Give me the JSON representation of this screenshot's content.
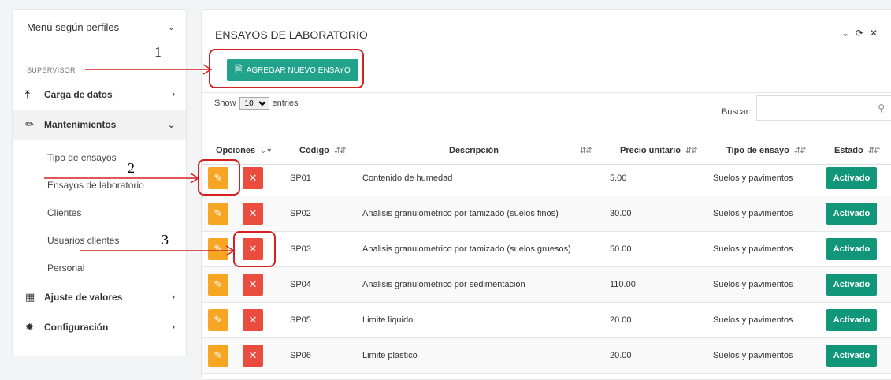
{
  "sidebar": {
    "title": "Menú según perfiles",
    "role": "SUPERVISOR",
    "items": [
      {
        "label": "Carga de datos",
        "icon": "upload-icon"
      },
      {
        "label": "Mantenimientos",
        "icon": "pencil-icon"
      },
      {
        "label": "Ajuste de valores",
        "icon": "calculator-icon"
      },
      {
        "label": "Configuración",
        "icon": "gear-icon"
      }
    ],
    "subitems": [
      "Tipo de ensayos",
      "Ensayos de laboratorio",
      "Clientes",
      "Usuarios clientes",
      "Personal"
    ]
  },
  "panel": {
    "title": "ENSAYOS DE LABORATORIO",
    "add_button": "AGREGAR NUEVO ENSAYO",
    "show_prefix": "Show",
    "show_value": "10",
    "show_suffix": "entries",
    "search_label": "Buscar:",
    "search_placeholder": ""
  },
  "table": {
    "headers": [
      "Opciones",
      "Código",
      "Descripción",
      "Precio unitario",
      "Tipo de ensayo",
      "Estado"
    ],
    "rows": [
      {
        "code": "SP01",
        "desc": "Contenido de humedad",
        "price": "5.00",
        "type": "Suelos y pavimentos",
        "status": "Activado"
      },
      {
        "code": "SP02",
        "desc": "Analisis granulometrico por tamizado (suelos finos)",
        "price": "30.00",
        "type": "Suelos y pavimentos",
        "status": "Activado"
      },
      {
        "code": "SP03",
        "desc": "Analisis granulometrico por tamizado (suelos gruesos)",
        "price": "50.00",
        "type": "Suelos y pavimentos",
        "status": "Activado"
      },
      {
        "code": "SP04",
        "desc": "Analisis granulometrico por sedimentacion",
        "price": "110.00",
        "type": "Suelos y pavimentos",
        "status": "Activado"
      },
      {
        "code": "SP05",
        "desc": "Limite liquido",
        "price": "20.00",
        "type": "Suelos y pavimentos",
        "status": "Activado"
      },
      {
        "code": "SP06",
        "desc": "Limite plastico",
        "price": "20.00",
        "type": "Suelos y pavimentos",
        "status": "Activado"
      }
    ]
  },
  "annotations": [
    "1",
    "2",
    "3"
  ],
  "colors": {
    "accent": "#20a28b",
    "edit": "#f6a623",
    "delete": "#ea4c3e",
    "status": "#12967a",
    "annotation": "#d42020"
  }
}
